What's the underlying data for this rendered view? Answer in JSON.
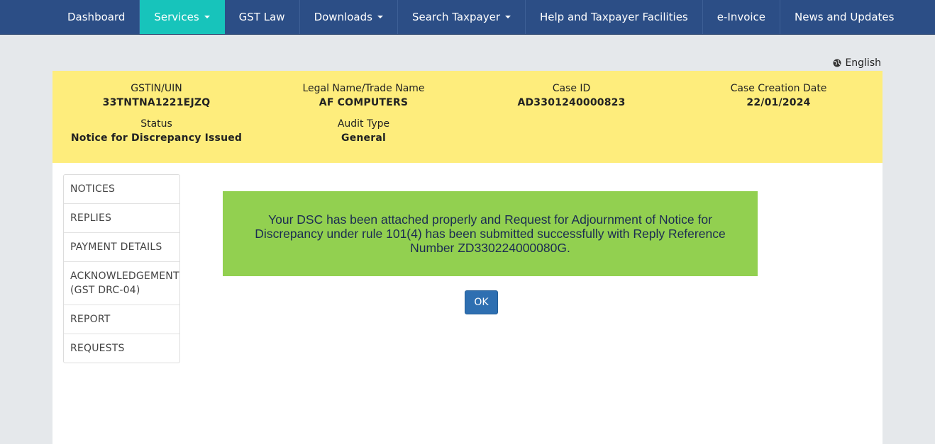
{
  "navbar": {
    "items": [
      {
        "label": "Dashboard",
        "dropdown": false
      },
      {
        "label": "Services",
        "dropdown": true,
        "active": true
      },
      {
        "label": "GST Law",
        "dropdown": false
      },
      {
        "label": "Downloads",
        "dropdown": true
      },
      {
        "label": "Search Taxpayer",
        "dropdown": true
      },
      {
        "label": "Help and Taxpayer Facilities",
        "dropdown": false
      },
      {
        "label": "e-Invoice",
        "dropdown": false
      },
      {
        "label": "News and Updates",
        "dropdown": false
      }
    ]
  },
  "language": {
    "label": "English",
    "icon": "globe-icon"
  },
  "case_info": {
    "gstin_label": "GSTIN/UIN",
    "gstin_value": "33TNTNA1221EJZQ",
    "legal_name_label": "Legal Name/Trade Name",
    "legal_name_value": "AF COMPUTERS",
    "case_id_label": "Case ID",
    "case_id_value": "AD3301240000823",
    "creation_date_label": "Case Creation Date",
    "creation_date_value": "22/01/2024",
    "status_label": "Status",
    "status_value": "Notice for Discrepancy Issued",
    "audit_type_label": "Audit Type",
    "audit_type_value": "General"
  },
  "side_nav": {
    "notices": "NOTICES",
    "replies": "REPLIES",
    "payment_details": "PAYMENT DETAILS",
    "acknowledgement": "ACKNOWLEDGEMENT",
    "acknowledgement_sub": "(GST DRC-04)",
    "report": "REPORT",
    "requests": "REQUESTS"
  },
  "alert": {
    "message": "Your DSC has been attached properly and Request for Adjournment of Notice for Discrepancy under rule 101(4) has been submitted successfully with Reply Reference Number ZD330224000080G."
  },
  "ok_button": {
    "label": "OK"
  },
  "colors": {
    "navbar": "#2c4e86",
    "active_tab": "#17c4bb",
    "info_bar": "#feed7c",
    "alert": "#92d050",
    "button": "#2e6fb1"
  }
}
